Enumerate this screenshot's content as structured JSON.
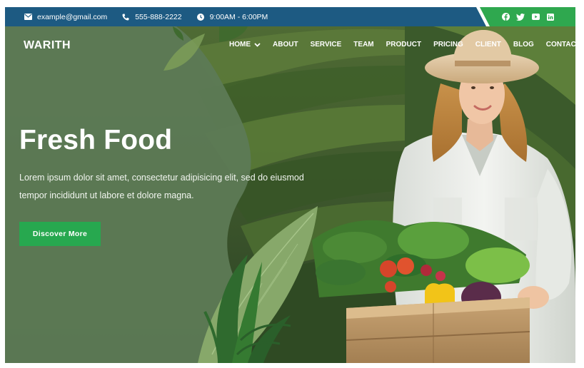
{
  "topbar": {
    "email": "example@gmail.com",
    "phone": "555-888-2222",
    "hours": "9:00AM - 6:00PM",
    "social": [
      "facebook-icon",
      "twitter-icon",
      "youtube-icon",
      "linkedin-icon"
    ],
    "colors": {
      "bar": "#1d5a82",
      "social_band": "#2fa84f"
    }
  },
  "brand": {
    "logo": "WARITH"
  },
  "nav": {
    "items": [
      "HOME",
      "ABOUT",
      "SERVICE",
      "TEAM",
      "PRODUCT",
      "PRICING",
      "CLIENT",
      "BLOG",
      "CONTACT"
    ]
  },
  "hero": {
    "title": "Fresh Food",
    "text": "Lorem ipsum dolor sit amet, consectetur adipisicing elit, sed do eiusmod tempor incididunt ut labore et dolore magna.",
    "cta": "Discover More",
    "colors": {
      "overlay": "#5d7a55",
      "cta": "#27a84f"
    }
  }
}
